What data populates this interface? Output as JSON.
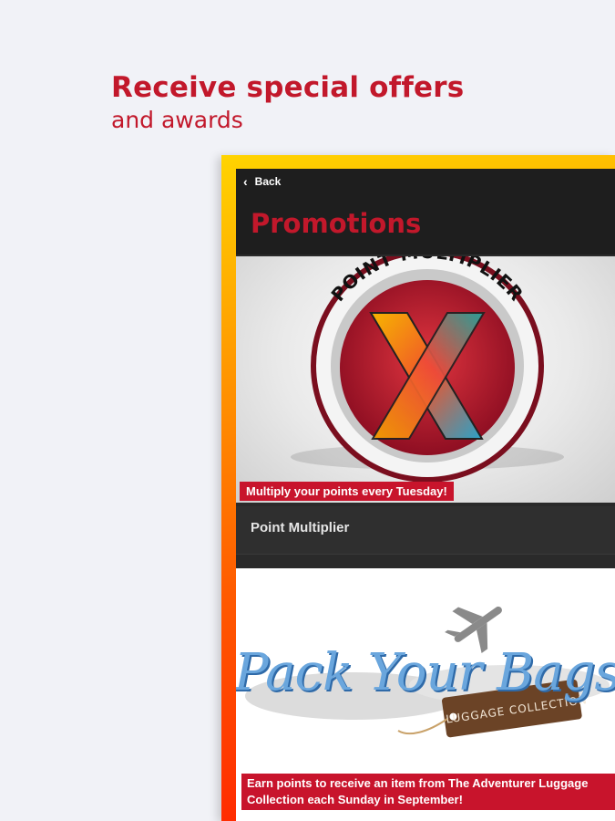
{
  "promo_header": {
    "headline": "Receive special offers",
    "subline": "and awards"
  },
  "app": {
    "back_label": "Back",
    "page_title": "Promotions",
    "cards": [
      {
        "badge_text": "POINT MULTIPLIER",
        "caption": "Multiply your points every Tuesday!",
        "name": "Point Multiplier"
      },
      {
        "badge_text": "Pack Your Bags",
        "tag_text": "LUGGAGE COLLECTION",
        "caption": "Earn points to receive an item from The Adventurer Luggage Collection each Sunday in September!"
      }
    ]
  },
  "colors": {
    "brand_red": "#c2182b",
    "frame_gradient_start": "#ffd400",
    "frame_gradient_end": "#ff1e00",
    "app_dark": "#1e1e1e"
  },
  "icons": {
    "back": "chevron-left-icon",
    "plane": "airplane-icon"
  }
}
